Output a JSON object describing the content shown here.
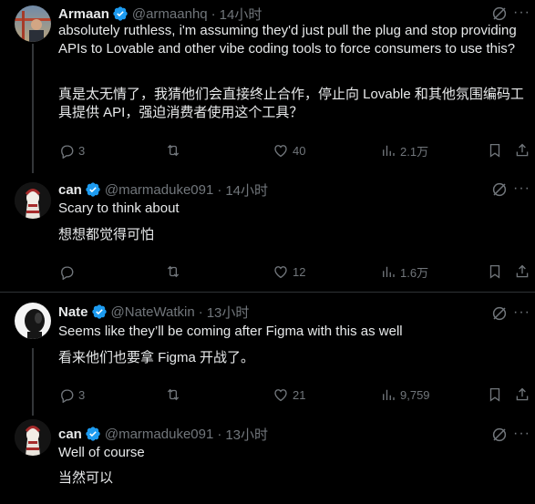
{
  "tweets": [
    {
      "name": "Armaan",
      "handle": "@armaanhq",
      "time": "14小时",
      "text_en": "absolutely ruthless, i'm assuming they'd just pull the plug and stop providing APIs to Lovable and other vibe coding tools to force consumers to use this?",
      "text_zh": "真是太无情了，我猜他们会直接终止合作，停止向 Lovable 和其他氛围编码工具提供 API，强迫消费者使用这个工具？",
      "replies": "3",
      "retweets": "",
      "likes": "40",
      "views": "2.1万"
    },
    {
      "name": "can",
      "handle": "@marmaduke091",
      "time": "14小时",
      "text_en": "Scary to think about",
      "text_zh": "想想都觉得可怕",
      "replies": "",
      "retweets": "",
      "likes": "12",
      "views": "1.6万"
    },
    {
      "name": "Nate",
      "handle": "@NateWatkin",
      "time": "13小时",
      "text_en": "Seems like they’ll be coming after Figma with this as well",
      "text_zh": "看来他们也要拿 Figma 开战了。",
      "replies": "3",
      "retweets": "",
      "likes": "21",
      "views": "9,759"
    },
    {
      "name": "can",
      "handle": "@marmaduke091",
      "time": "13小时",
      "text_en": "Well of course",
      "text_zh": "当然可以"
    }
  ],
  "separator": "·",
  "icons": [
    "grok-icon",
    "more-icon",
    "reply-icon",
    "retweet-icon",
    "like-icon",
    "views-icon",
    "bookmark-icon",
    "share-icon",
    "verified-icon"
  ],
  "colors": {
    "background": "#000000",
    "text": "#e7e9ea",
    "muted": "#71767b",
    "verified": "#1d9bf0",
    "divider": "#2f3336"
  }
}
